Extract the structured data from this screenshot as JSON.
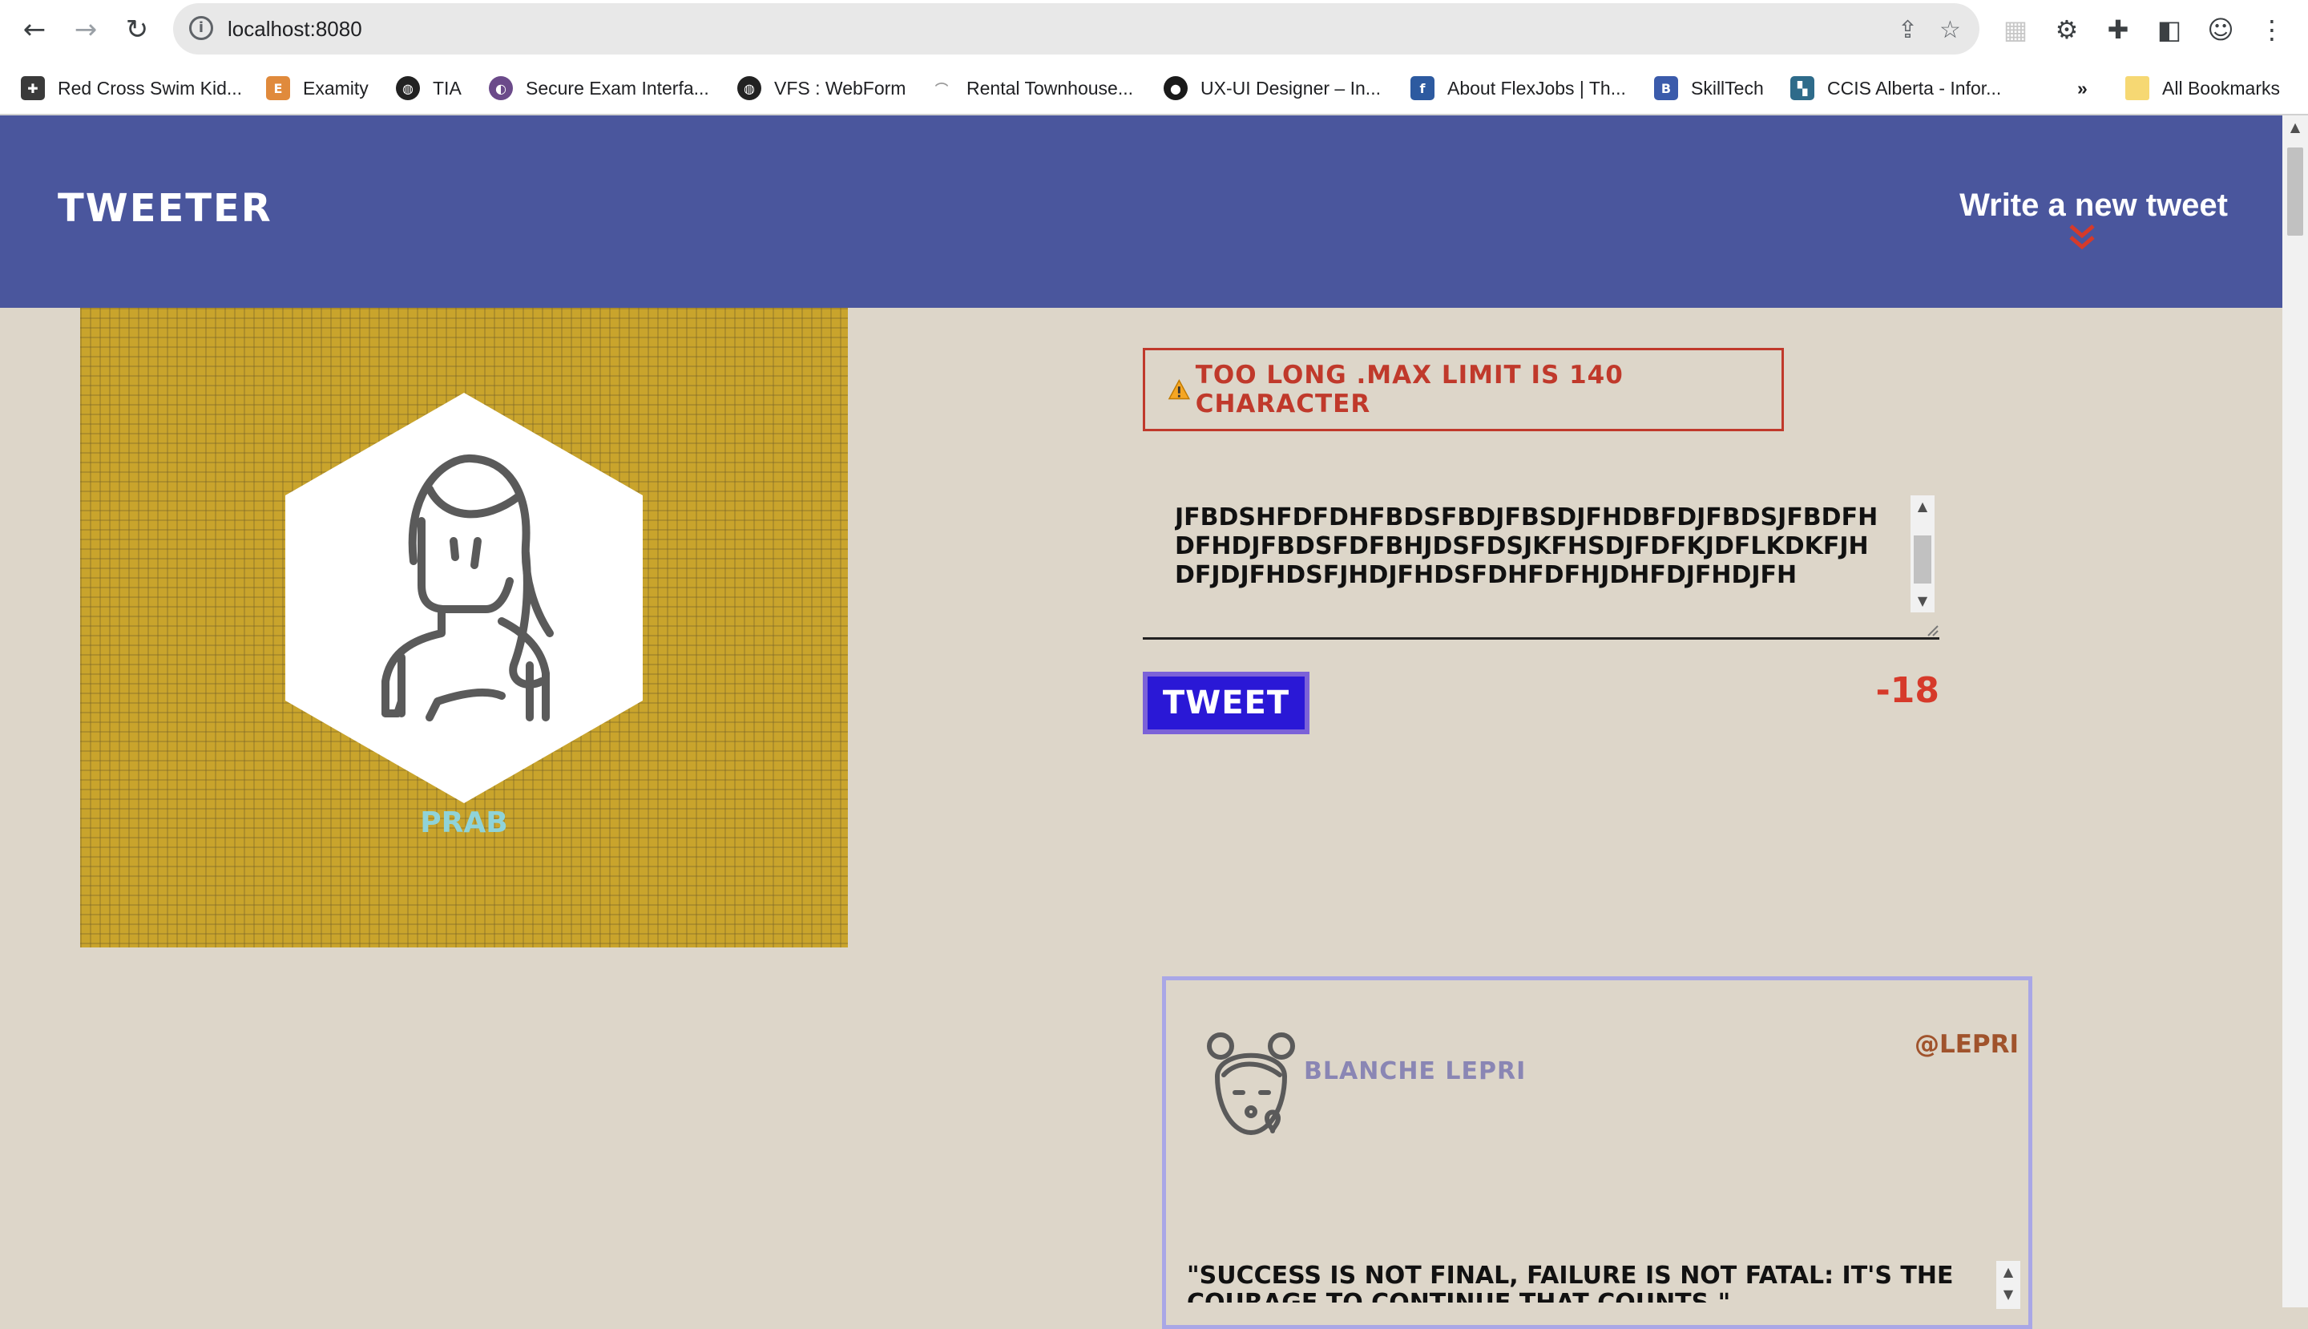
{
  "browser": {
    "url": "localhost:8080",
    "bookmarks": [
      {
        "label": "Red Cross Swim Kid...",
        "icon": "red-cross-favicon",
        "color": "#3a3a3a"
      },
      {
        "label": "Examity",
        "icon": "examity-favicon",
        "color": "#e08a3c"
      },
      {
        "label": "TIA",
        "icon": "globe-icon",
        "color": "#222222"
      },
      {
        "label": "Secure Exam Interfa...",
        "icon": "secure-exam-favicon",
        "color": "#6b4a8a"
      },
      {
        "label": "VFS : WebForm",
        "icon": "globe-icon",
        "color": "#222222"
      },
      {
        "label": "Rental Townhouse...",
        "icon": "rental-favicon",
        "color": "#9a9a9a"
      },
      {
        "label": "UX-UI Designer – In...",
        "icon": "ux-ui-favicon",
        "color": "#1a1a1a"
      },
      {
        "label": "About FlexJobs | Th...",
        "icon": "flexjobs-favicon",
        "color": "#2d5aa0"
      },
      {
        "label": "SkillTech",
        "icon": "skilltech-favicon",
        "color": "#3b5bab"
      },
      {
        "label": "CCIS Alberta - Infor...",
        "icon": "ccis-favicon",
        "color": "#2e6b8a"
      }
    ],
    "overflow_label": "»",
    "all_bookmarks_label": "All Bookmarks"
  },
  "header": {
    "brand": "Tweeter",
    "compose_label": "Write a new tweet"
  },
  "profile": {
    "name": "Prab"
  },
  "composer": {
    "error_message": "Too long .Max limit is 140 character",
    "text": "jfbdshfdfdhfbdsfbdjfbsdjfhdbfdjfbdsjfbdfhdfhdjfbdsfdfbhjdsfdsjkfhsdjfdfkjdflkdkfjhdfjdjfhdsfjhdjfhdsfdhfdfhjdhfdjfhdjfh",
    "button_label": "Tweet",
    "counter": "-18"
  },
  "tweet": {
    "author": "Blanche Lepri",
    "handle": "@lepri",
    "content": "\"Success is not final, failure is not fatal: it's the courage to continue that counts.\""
  },
  "colors": {
    "header_bg": "#4a569d",
    "page_bg": "#ddd6c9",
    "error": "#c0392b",
    "button_bg": "#2a18d6",
    "counter": "#d63a2a"
  }
}
